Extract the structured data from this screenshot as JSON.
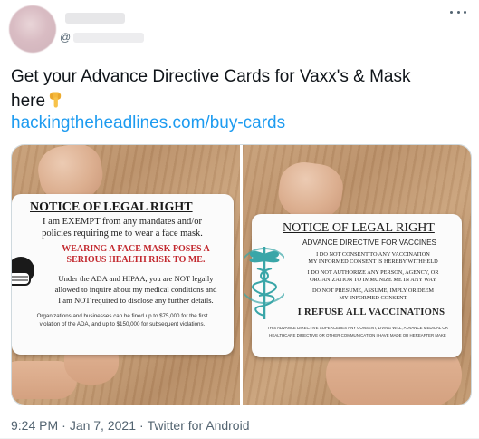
{
  "tweet": {
    "handle_prefix": "@",
    "text_line1": "Get your Advance Directive Cards for Vaxx's & Mask",
    "text_line2": "here",
    "emoji_icon": "backhand-index-pointing-down-icon",
    "link": "hackingtheheadlines.com/buy-cards",
    "time": "9:24 PM",
    "dot": "·",
    "date": "Jan 7, 2021",
    "source": "Twitter for Android"
  },
  "left_card": {
    "title": "NOTICE OF LEGAL RIGHT",
    "line1": "I am EXEMPT from any mandates and/or",
    "line2": "policies requiring me to wear a face mask.",
    "warning1": "WEARING A FACE MASK POSES A",
    "warning2": "SERIOUS HEALTH RISK TO ME.",
    "body1": "Under the ADA and HIPAA, you are NOT legally",
    "body2": "allowed to inquire about my medical conditions and",
    "body3": "I am NOT required to disclose any further details.",
    "fine1": "Organizations and businesses can be fined up to $75,000 for the first",
    "fine2": "violation of the ADA, and up to $150,000 for subsequent violations."
  },
  "right_card": {
    "title": "NOTICE OF LEGAL RIGHT",
    "subtitle": "ADVANCE DIRECTIVE FOR VACCINES",
    "p1a": "I DO NOT CONSENT TO ANY VACCINATION",
    "p1b": "MY INFORMED CONSENT IS HEREBY WITHHELD",
    "p2a": "I DO NOT AUTHORIZE ANY PERSON, AGENCY, OR",
    "p2b": "ORGANIZATION TO IMMUNIZE ME IN ANY WAY",
    "p3a": "DO NOT PRESUME, ASSUME, IMPLY OR DEEM",
    "p3b": "MY INFORMED CONSENT",
    "refuse": "I REFUSE ALL VACCINATIONS",
    "fine1": "THIS ADVANCE DIRECTIVE SUPERCEDES ANY CONSENT, LIVING WILL, ADVANCE MEDICAL OR",
    "fine2": "HEALTHCARE DIRECTIVE OR OTHER COMMUNICATION I HAVE MADE OR HEREAFTER MAKE"
  },
  "colors": {
    "link": "#1d9bf0",
    "text": "#0f1419",
    "muted": "#536471",
    "warning_red": "#c2272d",
    "caduceus_teal": "#3aa6a8"
  }
}
